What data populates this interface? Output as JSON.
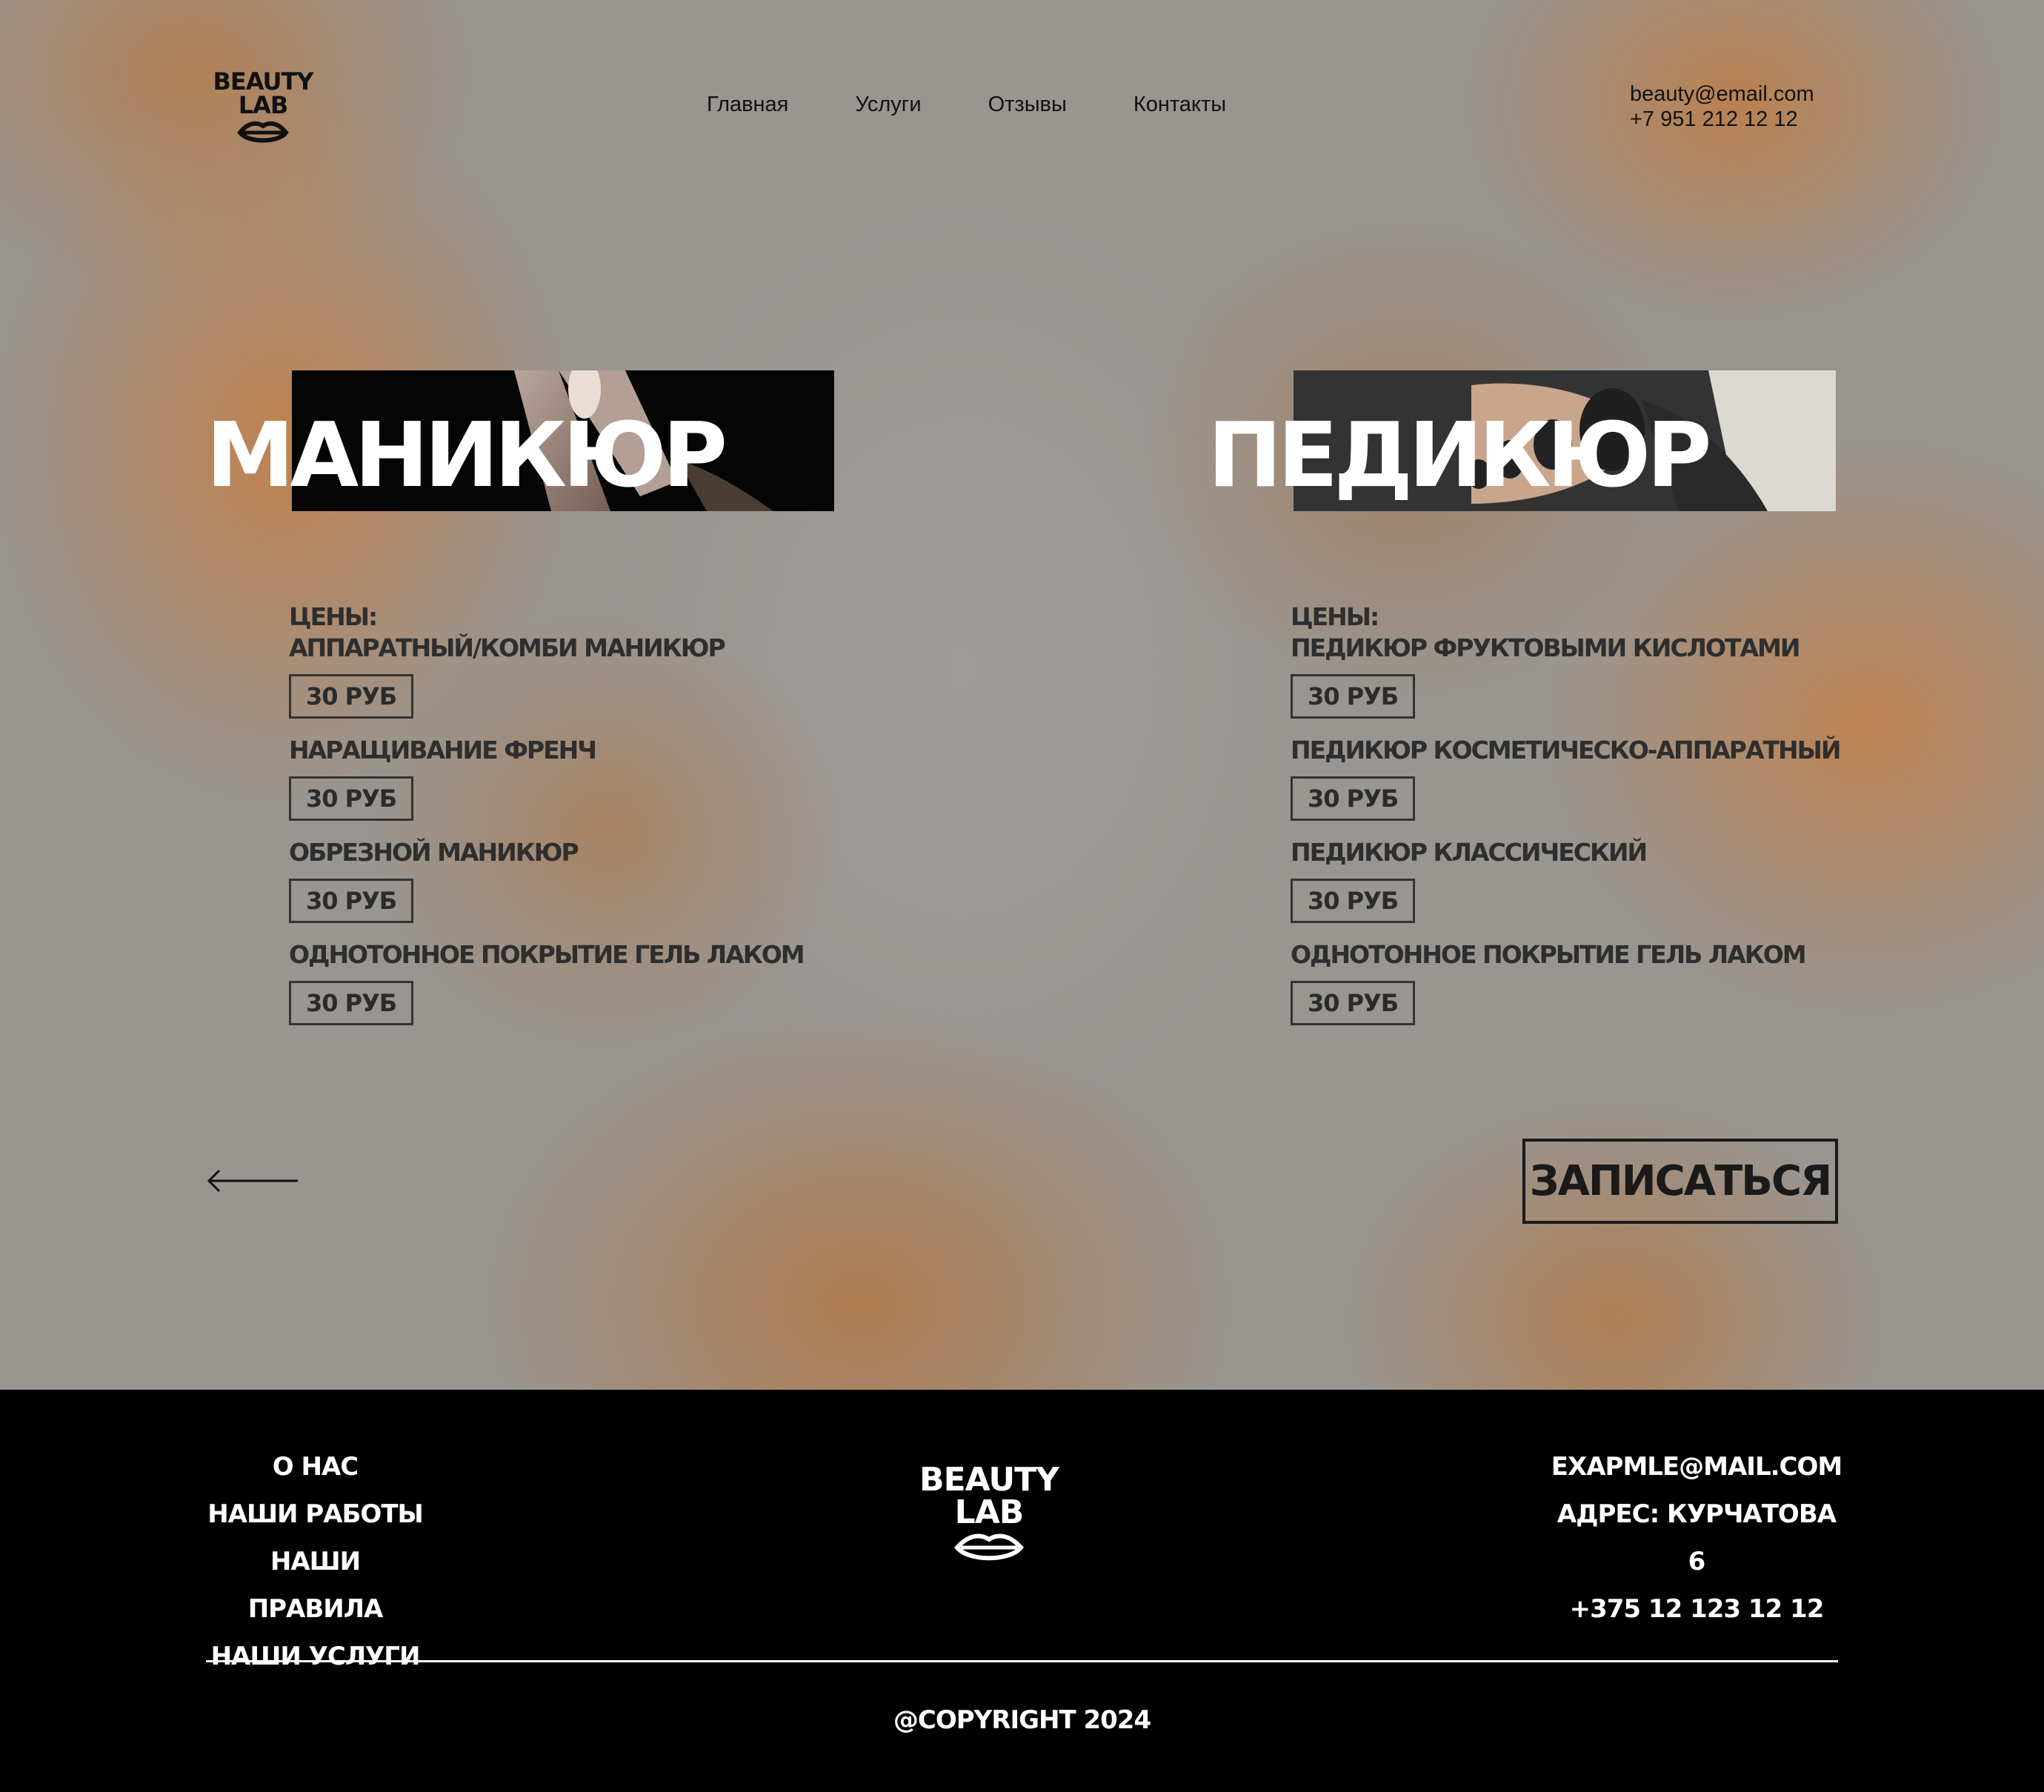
{
  "header": {
    "logo_line1": "BEAUTY",
    "logo_line2": "LAB",
    "nav": [
      "Главная",
      "Услуги",
      "Отзывы",
      "Контакты"
    ],
    "email": "beauty@email.com",
    "phone": "+7 951 212 12 12"
  },
  "manicure": {
    "title": "МАНИКЮР",
    "prices_label": "ЦЕНЫ:",
    "items": [
      {
        "name": "АППАРАТНЫЙ/КОМБИ МАНИКЮР",
        "price": "30 РУБ"
      },
      {
        "name": "НАРАЩИВАНИЕ ФРЕНЧ",
        "price": "30 РУБ"
      },
      {
        "name": "ОБРЕЗНОЙ МАНИКЮР",
        "price": "30 РУБ"
      },
      {
        "name": "ОДНОТОННОЕ ПОКРЫТИЕ ГЕЛЬ ЛАКОМ",
        "price": "30 РУБ"
      }
    ]
  },
  "pedicure": {
    "title": "ПЕДИКЮР",
    "prices_label": "ЦЕНЫ:",
    "items": [
      {
        "name": "ПЕДИКЮР ФРУКТОВЫМИ КИСЛОТАМИ",
        "price": "30 РУБ"
      },
      {
        "name": "ПЕДИКЮР КОСМЕТИЧЕСКО-АППАРАТНЫЙ",
        "price": "30 РУБ"
      },
      {
        "name": "ПЕДИКЮР КЛАССИЧЕСКИЙ",
        "price": "30 РУБ"
      },
      {
        "name": "ОДНОТОННОЕ ПОКРЫТИЕ ГЕЛЬ ЛАКОМ",
        "price": "30 РУБ"
      }
    ]
  },
  "actions": {
    "back_icon": "arrow-left-icon",
    "book_label": "ЗАПИСАТЬСЯ"
  },
  "footer": {
    "links": [
      "О НАС",
      "НАШИ РАБОТЫ",
      "НАШИ ПРАВИЛА",
      "НАШИ УСЛУГИ"
    ],
    "logo_line1": "BEAUTY",
    "logo_line2": "LAB",
    "email": "EXAPMLE@MAIL.COM",
    "address": "АДРЕС: КУРЧАТОВА 6",
    "phone": "+375 12 123 12 12",
    "copyright": "@COPYRIGHT 2024"
  },
  "colors": {
    "accent_brown": "#c48048",
    "footer_bg": "#000000",
    "text_dark": "#2e2e2e"
  }
}
